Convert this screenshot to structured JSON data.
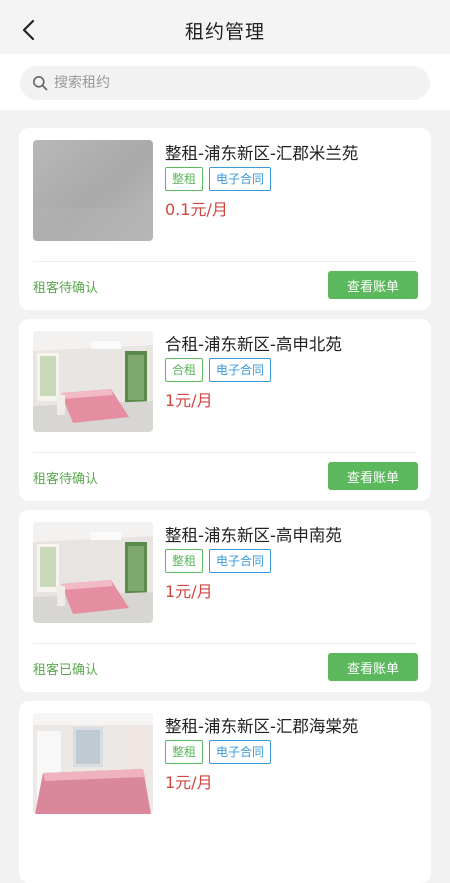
{
  "header": {
    "title": "租约管理"
  },
  "search": {
    "placeholder": "搜索租约"
  },
  "leases": [
    {
      "title": "整租-浦东新区-汇郡米兰苑",
      "type_tag": "整租",
      "contract_tag": "电子合同",
      "price": "0.1元/月",
      "status": "租客待确认",
      "button_label": "查看账单"
    },
    {
      "title": "合租-浦东新区-高申北苑",
      "type_tag": "合租",
      "contract_tag": "电子合同",
      "price": "1元/月",
      "status": "租客待确认",
      "button_label": "查看账单"
    },
    {
      "title": "整租-浦东新区-高申南苑",
      "type_tag": "整租",
      "contract_tag": "电子合同",
      "price": "1元/月",
      "status": "租客已确认",
      "button_label": "查看账单"
    },
    {
      "title": "整租-浦东新区-汇郡海棠苑",
      "type_tag": "整租",
      "contract_tag": "电子合同",
      "price": "1元/月",
      "status": "",
      "button_label": ""
    }
  ],
  "colors": {
    "accent_green": "#5cb85c",
    "contract_blue": "#3a9ad9",
    "price_red": "#d0463f"
  }
}
